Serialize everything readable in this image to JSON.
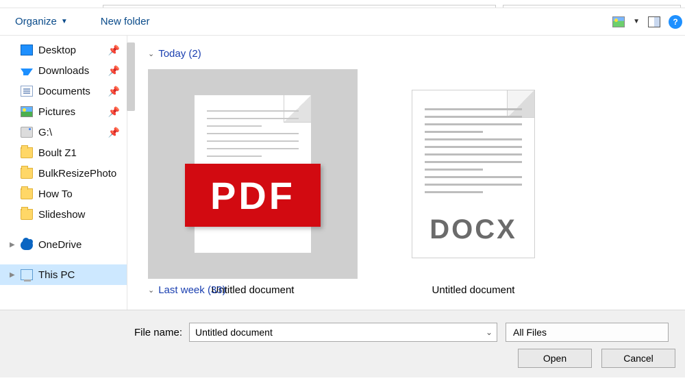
{
  "toolbar": {
    "organize": "Organize",
    "new_folder": "New folder"
  },
  "sidebar": {
    "items": [
      {
        "label": "Desktop",
        "pin": "📌"
      },
      {
        "label": "Downloads",
        "pin": "📌"
      },
      {
        "label": "Documents",
        "pin": "📌"
      },
      {
        "label": "Pictures",
        "pin": "📌"
      },
      {
        "label": "G:\\",
        "pin": "📌"
      },
      {
        "label": "Boult Z1"
      },
      {
        "label": "BulkResizePhoto"
      },
      {
        "label": "How To"
      },
      {
        "label": "Slideshow"
      }
    ],
    "onedrive": "OneDrive",
    "thispc": "This PC"
  },
  "content": {
    "group1": {
      "label": "Today",
      "count": "(2)"
    },
    "file1": {
      "name": "Untitled document",
      "badge": "PDF"
    },
    "file2": {
      "name": "Untitled document",
      "badge": "DOCX"
    },
    "group2": {
      "label": "Last week",
      "count": "(33)"
    }
  },
  "footer": {
    "file_name_label": "File name:",
    "file_name_value": "Untitled document",
    "file_type": "All Files",
    "open": "Open",
    "cancel": "Cancel"
  }
}
